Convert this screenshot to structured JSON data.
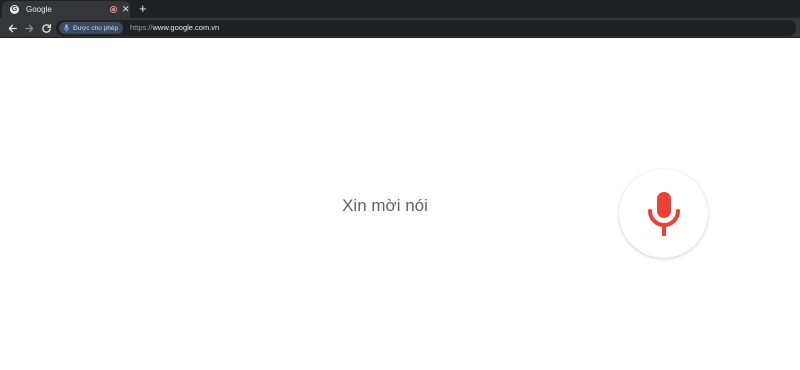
{
  "tab": {
    "title": "Google",
    "favicon_letter": "G",
    "close_glyph": "✕"
  },
  "new_tab_glyph": "+",
  "toolbar": {
    "permission_chip": "Được cho phép",
    "url_scheme": "https://",
    "url_host": "www.google.com.vn"
  },
  "page": {
    "prompt": "Xin mời nói"
  },
  "colors": {
    "mic_red": "#ea4335",
    "tab_recording_dot": "#f28b82"
  },
  "icons": [
    "google-favicon-icon",
    "recording-icon",
    "close-icon",
    "plus-icon",
    "back-arrow-icon",
    "forward-arrow-icon",
    "reload-icon",
    "microphone-icon"
  ]
}
